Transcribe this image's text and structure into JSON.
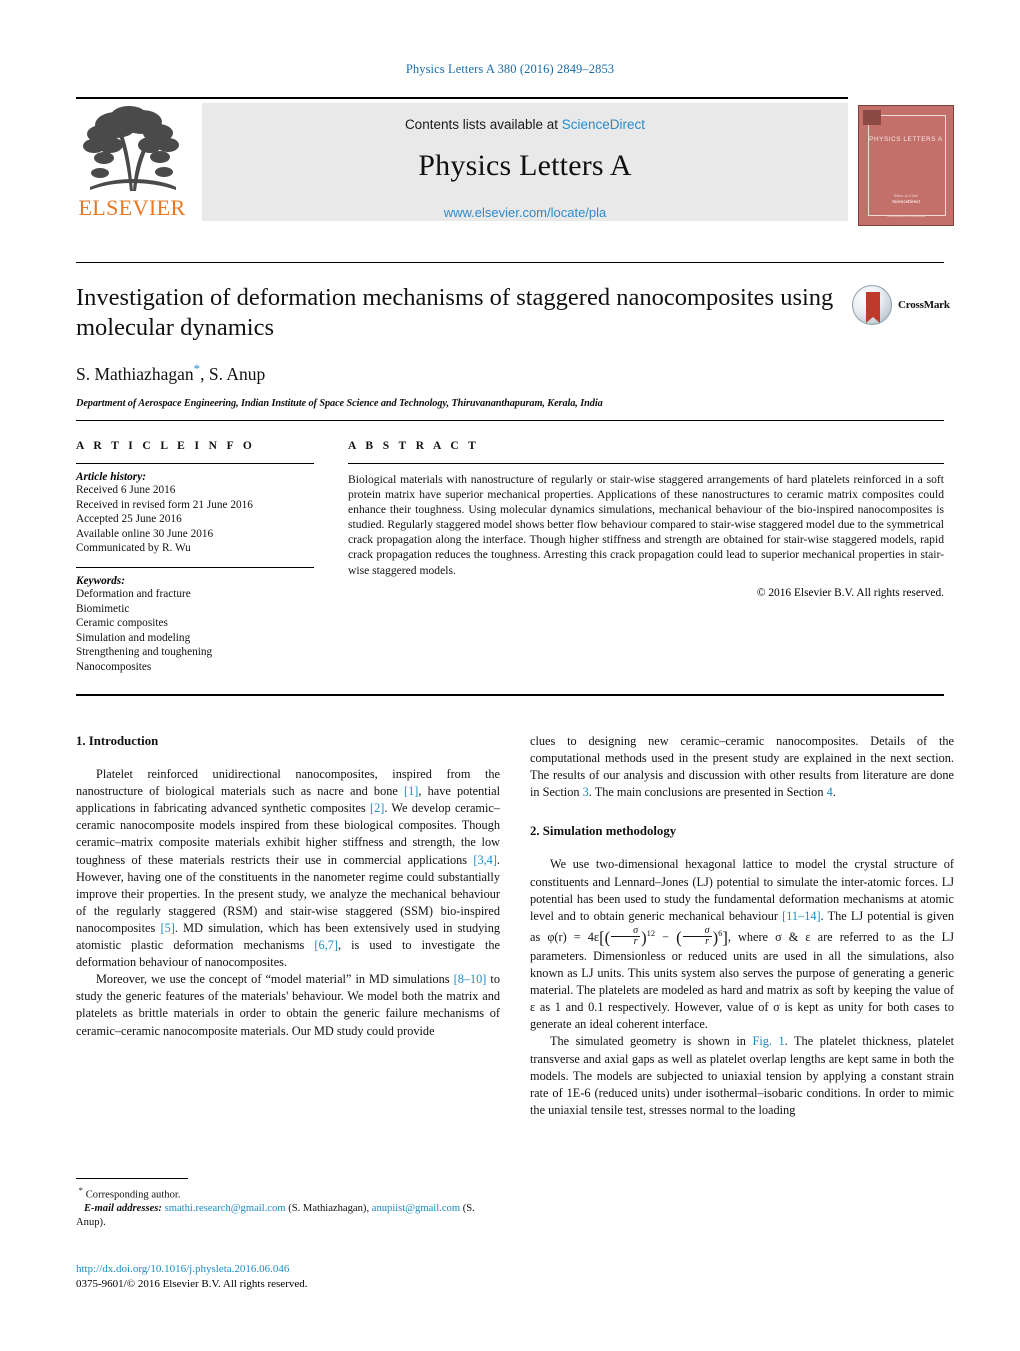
{
  "running_head": "Physics Letters A 380 (2016) 2849–2853",
  "masthead": {
    "contents_prefix": "Contents lists available at ",
    "sciencedirect": "ScienceDirect",
    "journal_name": "Physics Letters A",
    "journal_url": "www.elsevier.com/locate/pla",
    "publisher_wordmark": "ELSEVIER",
    "cover": {
      "title": "PHYSICS LETTERS A",
      "foot1": "Editor-in-Chief",
      "foot2": "ScienceDirect",
      "foot3": "www.elsevier.com/locate/pla"
    }
  },
  "title_block": {
    "title": "Investigation of deformation mechanisms of staggered nanocomposites using molecular dynamics",
    "authors": "S. Mathiazhagan",
    "authors_tail": ", S. Anup",
    "corresponding_marker": "*",
    "affiliation": "Department of Aerospace Engineering, Indian Institute of Space Science and Technology, Thiruvananthapuram, Kerala, India",
    "crossmark_label": "CrossMark"
  },
  "article_info": {
    "heading": "A R T I C L E     I N F O",
    "history_label": "Article history:",
    "history": [
      "Received 6 June 2016",
      "Received in revised form 21 June 2016",
      "Accepted 25 June 2016",
      "Available online 30 June 2016",
      "Communicated by R. Wu"
    ],
    "keywords_label": "Keywords:",
    "keywords": [
      "Deformation and fracture",
      "Biomimetic",
      "Ceramic composites",
      "Simulation and modeling",
      "Strengthening and toughening",
      "Nanocomposites"
    ]
  },
  "abstract": {
    "heading": "A B S T R A C T",
    "text": "Biological materials with nanostructure of regularly or stair-wise staggered arrangements of hard platelets reinforced in a soft protein matrix have superior mechanical properties. Applications of these nanostructures to ceramic matrix composites could enhance their toughness. Using molecular dynamics simulations, mechanical behaviour of the bio-inspired nanocomposites is studied. Regularly staggered model shows better flow behaviour compared to stair-wise staggered model due to the symmetrical crack propagation along the interface. Though higher stiffness and strength are obtained for stair-wise staggered models, rapid crack propagation reduces the toughness. Arresting this crack propagation could lead to superior mechanical properties in stair-wise staggered models.",
    "copyright": "© 2016 Elsevier B.V. All rights reserved."
  },
  "body": {
    "section1_heading": "1. Introduction",
    "section2_heading": "2. Simulation methodology",
    "left_p1_a": "Platelet reinforced unidirectional nanocomposites, inspired from the nanostructure of biological materials such as nacre and bone ",
    "left_p1_ref1": "[1]",
    "left_p1_b": ", have potential applications in fabricating advanced synthetic composites ",
    "left_p1_ref2": "[2]",
    "left_p1_c": ". We develop ceramic–ceramic nanocomposite models inspired from these biological composites. Though ceramic–matrix composite materials exhibit higher stiffness and strength, the low toughness of these materials restricts their use in commercial applications ",
    "left_p1_ref3": "[3,4]",
    "left_p1_d": ". However, having one of the constituents in the nanometer regime could substantially improve their properties. In the present study, we analyze the mechanical behaviour of the regularly staggered (RSM) and stair-wise staggered (SSM) bio-inspired nanocomposites ",
    "left_p1_ref4": "[5]",
    "left_p1_e": ". MD simulation, which has been extensively used in studying atomistic plastic deformation mechanisms ",
    "left_p1_ref5": "[6,7]",
    "left_p1_f": ", is used to investigate the deformation behaviour of nanocomposites.",
    "left_p2_a": "Moreover, we use the concept of “model material” in MD simulations ",
    "left_p2_ref1": "[8–10]",
    "left_p2_b": " to study the generic features of the materials' behaviour. We model both the matrix and platelets as brittle materials in order to obtain the generic failure mechanisms of ceramic–ceramic nanocomposite materials. Our MD study could provide",
    "right_p1_a": "clues to designing new ceramic–ceramic nanocomposites. Details of the computational methods used in the present study are explained in the next section. The results of our analysis and discussion with other results from literature are done in Section ",
    "right_p1_ref1": "3",
    "right_p1_b": ". The main conclusions are presented in Section ",
    "right_p1_ref2": "4",
    "right_p1_c": ".",
    "right_p2_a": "We use two-dimensional hexagonal lattice to model the crystal structure of constituents and Lennard–Jones (LJ) potential to simulate the inter-atomic forces. LJ potential has been used to study the fundamental deformation mechanisms at atomic level and to obtain generic mechanical behaviour ",
    "right_p2_ref1": "[11–14]",
    "right_p2_b": ". The LJ potential is given as ",
    "right_p2_eq_phi": "φ(r) = 4ε",
    "right_p2_eq_sigma": "σ",
    "right_p2_eq_r": "r",
    "right_p2_eq_exp1": "12",
    "right_p2_eq_exp2": "6",
    "right_p2_c": ", where σ & ε are referred to as the LJ parameters. Dimensionless or reduced units are used in all the simulations, also known as LJ units. This units system also serves the purpose of generating a generic material. The platelets are modeled as hard and matrix as soft by keeping the value of ε as 1 and 0.1 respectively. However, value of σ is kept as unity for both cases to generate an ideal coherent interface.",
    "right_p3_a": "The simulated geometry is shown in ",
    "right_p3_ref1": "Fig. 1",
    "right_p3_b": ". The platelet thickness, platelet transverse and axial gaps as well as platelet overlap lengths are kept same in both the models. The models are subjected to uniaxial tension by applying a constant strain rate of 1E-6 (reduced units) under isothermal–isobaric conditions. In order to mimic the uniaxial tensile test, stresses normal to the loading"
  },
  "footnote": {
    "corresponding": "Corresponding author.",
    "email_label": "E-mail addresses:",
    "email1": "smathi.research@gmail.com",
    "email1_owner": " (S. Mathiazhagan),",
    "email2": "anupiist@gmail.com",
    "email2_owner": " (S. Anup).",
    "doi": "http://dx.doi.org/10.1016/j.physleta.2016.06.046",
    "issn_line": "0375-9601/© 2016 Elsevier B.V. All rights reserved."
  },
  "colors": {
    "link_blue": "#1b8cc4",
    "elsevier_orange": "#E87722",
    "cover_red": "#c4706a",
    "band_grey": "#e9e9e9"
  }
}
